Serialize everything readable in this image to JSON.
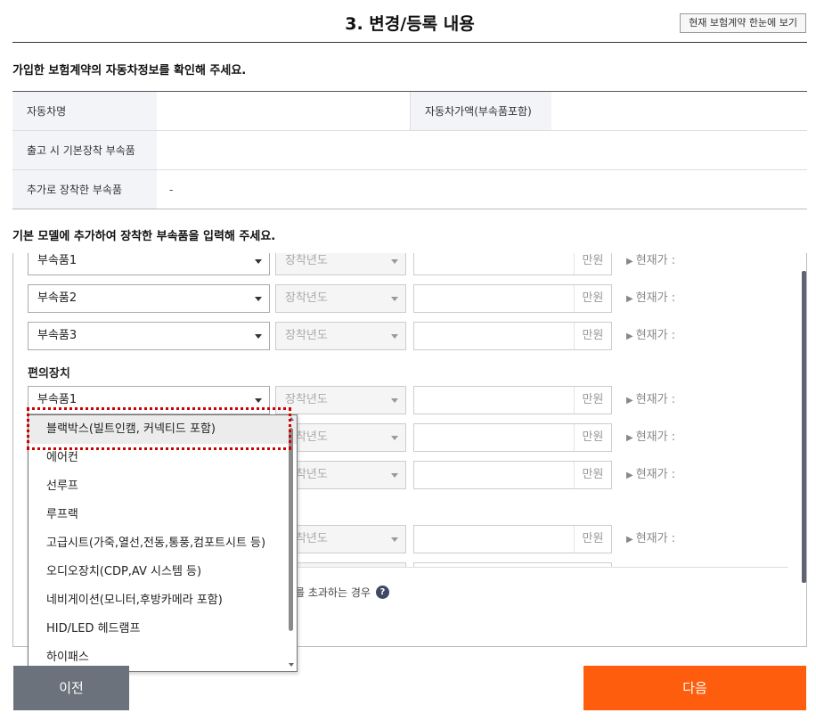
{
  "header": {
    "title": "3. 변경/등록 내용",
    "summary_button": "현재 보험계약 한눈에 보기"
  },
  "car_info": {
    "heading": "가입한 보험계약의 자동차정보를 확인해 주세요.",
    "car_name_label": "자동차명",
    "car_name_value": "",
    "car_price_label": "자동차가액(부속품포함)",
    "car_price_value": "",
    "default_parts_label": "출고 시 기본장착 부속품",
    "default_parts_value": "",
    "added_parts_label": "추가로 장착한 부속품",
    "added_parts_value": "-"
  },
  "parts": {
    "heading": "기본 모델에 추가하여 장착한 부속품을 입력해 주세요.",
    "year_placeholder": "장착년도",
    "unit": "만원",
    "current_price_label": "현재가 :",
    "group1_rows": [
      "부속품1",
      "부속품2",
      "부속품3"
    ],
    "group2_label": "편의장치",
    "group2_first": "부속품1",
    "help_text": "를 초과하는 경우",
    "help_icon": "?"
  },
  "dropdown": {
    "options": [
      "블랙박스(빌트인캠, 커넥티드 포함)",
      "에어컨",
      "선루프",
      "루프랙",
      "고급시트(가죽,열선,전동,통풍,컴포트시트 등)",
      "오디오장치(CDP,AV 시스템 등)",
      "네비게이션(모니터,후방카메라 포함)",
      "HID/LED 헤드램프",
      "하이패스"
    ],
    "active_index": 0
  },
  "buttons": {
    "prev": "이전",
    "next": "다음"
  },
  "colors": {
    "next_button": "#fd5d0d",
    "prev_button": "#6b727b",
    "highlight_border": "#d10000",
    "help_icon": "#3e4a63"
  }
}
